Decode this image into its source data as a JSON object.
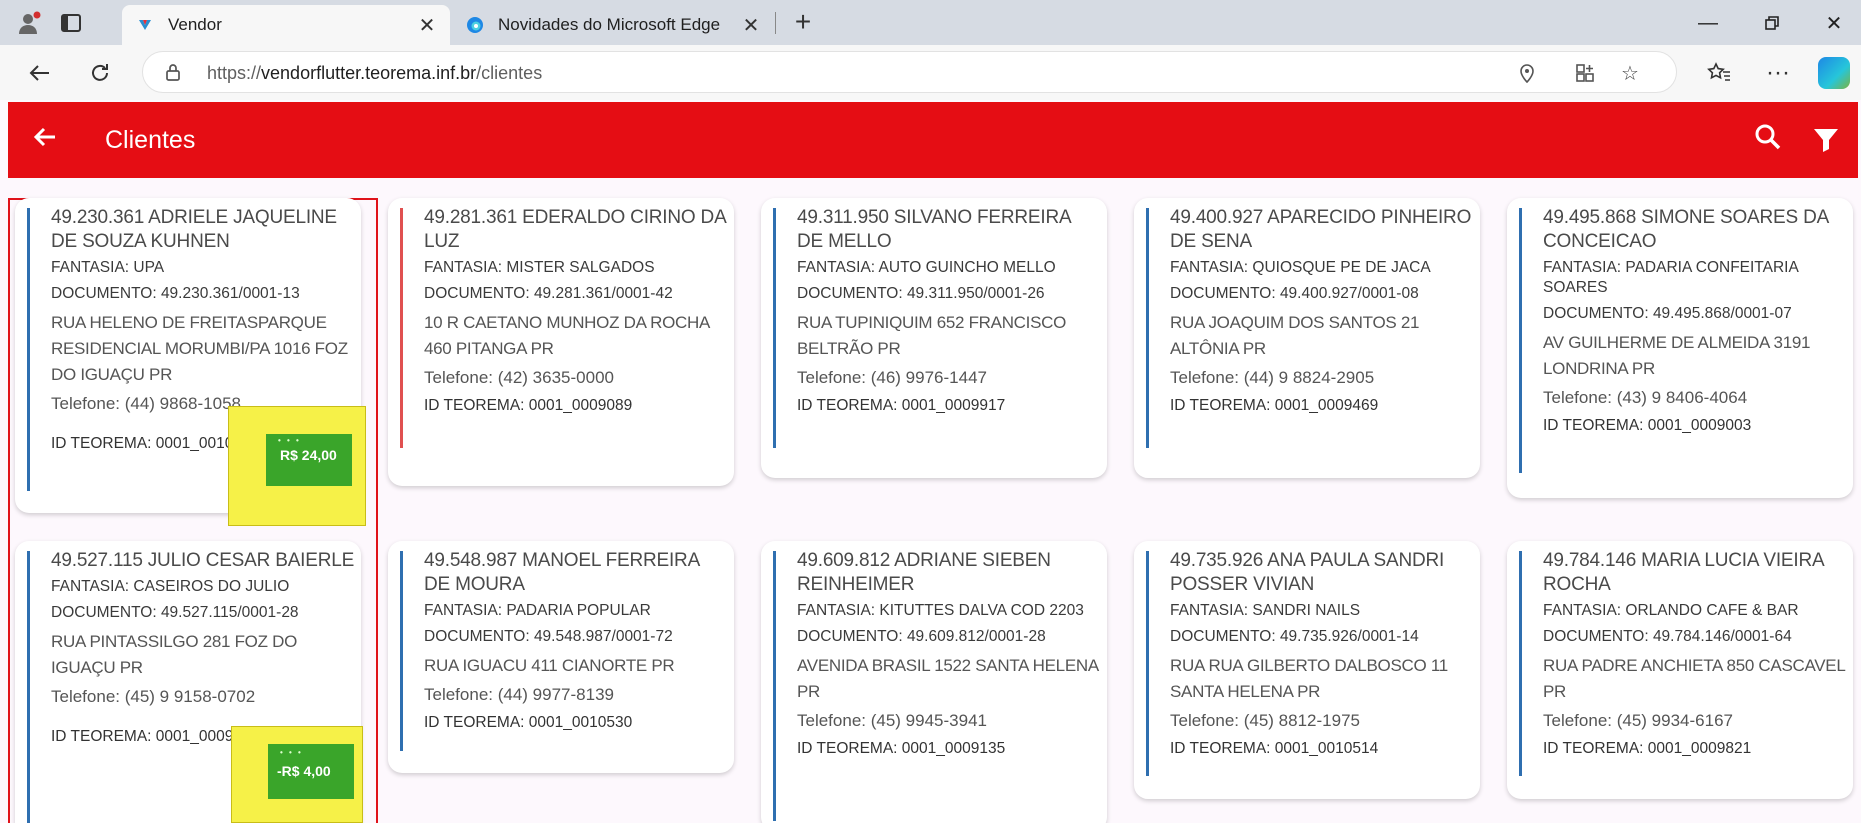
{
  "browser": {
    "tabs": [
      {
        "title": "Vendor"
      },
      {
        "title": "Novidades do Microsoft Edge"
      }
    ],
    "url_prefix": "https://",
    "url_domain": "vendorflutter.teorema.inf.br",
    "url_path": "/clientes"
  },
  "appbar": {
    "title": "Clientes"
  },
  "clients": [
    {
      "name": "49.230.361 ADRIELE JAQUELINE DE SOUZA KUHNEN",
      "fantasia": "FANTASIA: UPA",
      "documento": "DOCUMENTO: 49.230.361/0001-13",
      "endereco": "RUA HELENO DE FREITASPARQUE RESIDENCIAL MORUMBI/PA 1016 FOZ DO IGUAÇU PR",
      "telefone": "Telefone: (44) 9868-1058",
      "id": "ID TEOREMA: 0001_001025",
      "badge": "R$ 24,00"
    },
    {
      "name": "49.281.361 EDERALDO CIRINO DA LUZ",
      "fantasia": "FANTASIA: MISTER SALGADOS",
      "documento": "DOCUMENTO: 49.281.361/0001-42",
      "endereco": "10 R CAETANO MUNHOZ DA ROCHA 460 PITANGA PR",
      "telefone": "Telefone: (42) 3635-0000",
      "id": "ID TEOREMA: 0001_0009089"
    },
    {
      "name": "49.311.950 SILVANO FERREIRA DE MELLO",
      "fantasia": "FANTASIA: AUTO GUINCHO MELLO",
      "documento": "DOCUMENTO: 49.311.950/0001-26",
      "endereco": "RUA TUPINIQUIM 652 FRANCISCO BELTRÃO PR",
      "telefone": "Telefone: (46) 9976-1447",
      "id": "ID TEOREMA: 0001_0009917"
    },
    {
      "name": "49.400.927 APARECIDO PINHEIRO DE SENA",
      "fantasia": "FANTASIA: QUIOSQUE PE DE JACA",
      "documento": "DOCUMENTO: 49.400.927/0001-08",
      "endereco": "RUA JOAQUIM DOS SANTOS 21 ALTÔNIA PR",
      "telefone": "Telefone: (44) 9 8824-2905",
      "id": "ID TEOREMA: 0001_0009469"
    },
    {
      "name": "49.495.868 SIMONE SOARES DA CONCEICAO",
      "fantasia": "FANTASIA: PADARIA  CONFEITARIA SOARES",
      "documento": "DOCUMENTO: 49.495.868/0001-07",
      "endereco": "AV GUILHERME DE ALMEIDA 3191 LONDRINA PR",
      "telefone": "Telefone: (43) 9 8406-4064",
      "id": "ID TEOREMA: 0001_0009003"
    },
    {
      "name": "49.527.115 JULIO CESAR BAIERLE",
      "fantasia": "FANTASIA: CASEIROS DO JULIO",
      "documento": "DOCUMENTO: 49.527.115/0001-28",
      "endereco": "RUA PINTASSILGO 281 FOZ DO IGUAÇU PR",
      "telefone": "Telefone: (45) 9 9158-0702",
      "id": "ID TEOREMA: 0001_000978",
      "badge": "-R$ 4,00"
    },
    {
      "name": "49.548.987 MANOEL FERREIRA DE MOURA",
      "fantasia": "FANTASIA: PADARIA POPULAR",
      "documento": "DOCUMENTO: 49.548.987/0001-72",
      "endereco": "RUA IGUACU 411 CIANORTE PR",
      "telefone": "Telefone: (44) 9977-8139",
      "id": "ID TEOREMA: 0001_0010530"
    },
    {
      "name": "49.609.812 ADRIANE SIEBEN REINHEIMER",
      "fantasia": "FANTASIA: KITUTTES DALVA COD 2203",
      "documento": "DOCUMENTO: 49.609.812/0001-28",
      "endereco": "AVENIDA BRASIL 1522 SANTA HELENA PR",
      "telefone": "Telefone: (45) 9945-3941",
      "id": "ID TEOREMA: 0001_0009135"
    },
    {
      "name": "49.735.926 ANA PAULA SANDRI POSSER VIVIAN",
      "fantasia": "FANTASIA: SANDRI NAILS",
      "documento": "DOCUMENTO: 49.735.926/0001-14",
      "endereco": "RUA RUA GILBERTO DALBOSCO 11 SANTA HELENA PR",
      "telefone": "Telefone: (45) 8812-1975",
      "id": "ID TEOREMA: 0001_0010514"
    },
    {
      "name": "49.784.146 MARIA LUCIA VIEIRA ROCHA",
      "fantasia": "FANTASIA: ORLANDO CAFE & BAR",
      "documento": "DOCUMENTO: 49.784.146/0001-64",
      "endereco": "RUA PADRE ANCHIETA 850 CASCAVEL PR",
      "telefone": "Telefone: (45) 9934-6167",
      "id": "ID TEOREMA: 0001_0009821"
    }
  ],
  "colors": {
    "appbar": "#e50d14",
    "card_accent": "#2f6fb0",
    "badge": "#3aa52a",
    "highlight": "#f6f148"
  }
}
